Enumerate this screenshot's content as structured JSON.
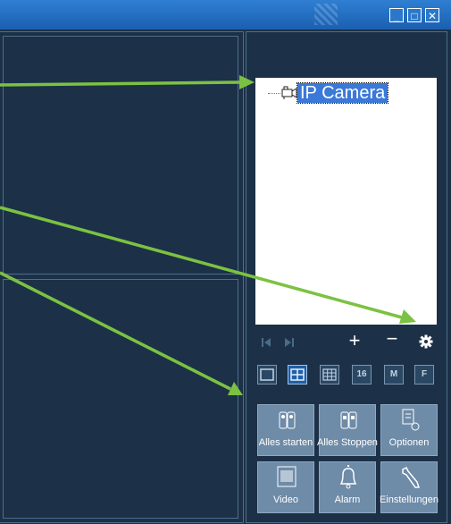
{
  "window": {
    "minimize_icon": "minimize-icon",
    "maximize_icon": "maximize-icon",
    "close_icon": "close-icon"
  },
  "device_tree": {
    "items": [
      {
        "label": "IP Camera",
        "icon": "camera-icon"
      }
    ]
  },
  "tree_controls": {
    "prev": "skip-back-icon",
    "next": "skip-forward-icon",
    "add": "+",
    "remove": "−",
    "settings": "gear-icon"
  },
  "layout_buttons": [
    {
      "name": "single",
      "text": ""
    },
    {
      "name": "quad",
      "text": "",
      "active": true
    },
    {
      "name": "nine",
      "text": ""
    },
    {
      "name": "sixteen",
      "text": "16"
    },
    {
      "name": "m",
      "text": "M"
    },
    {
      "name": "f",
      "text": "F"
    }
  ],
  "action_buttons": {
    "start_all": "Alles starten",
    "stop_all": "Alles Stoppen",
    "options": "Optionen",
    "video": "Video",
    "alarm": "Alarm",
    "settings": "Einstellungen"
  },
  "colors": {
    "background": "#1c3147",
    "titlebar": "#2f7fd3",
    "selection": "#3b79d8",
    "button": "#6e8ba8",
    "arrow": "#7cc242"
  }
}
